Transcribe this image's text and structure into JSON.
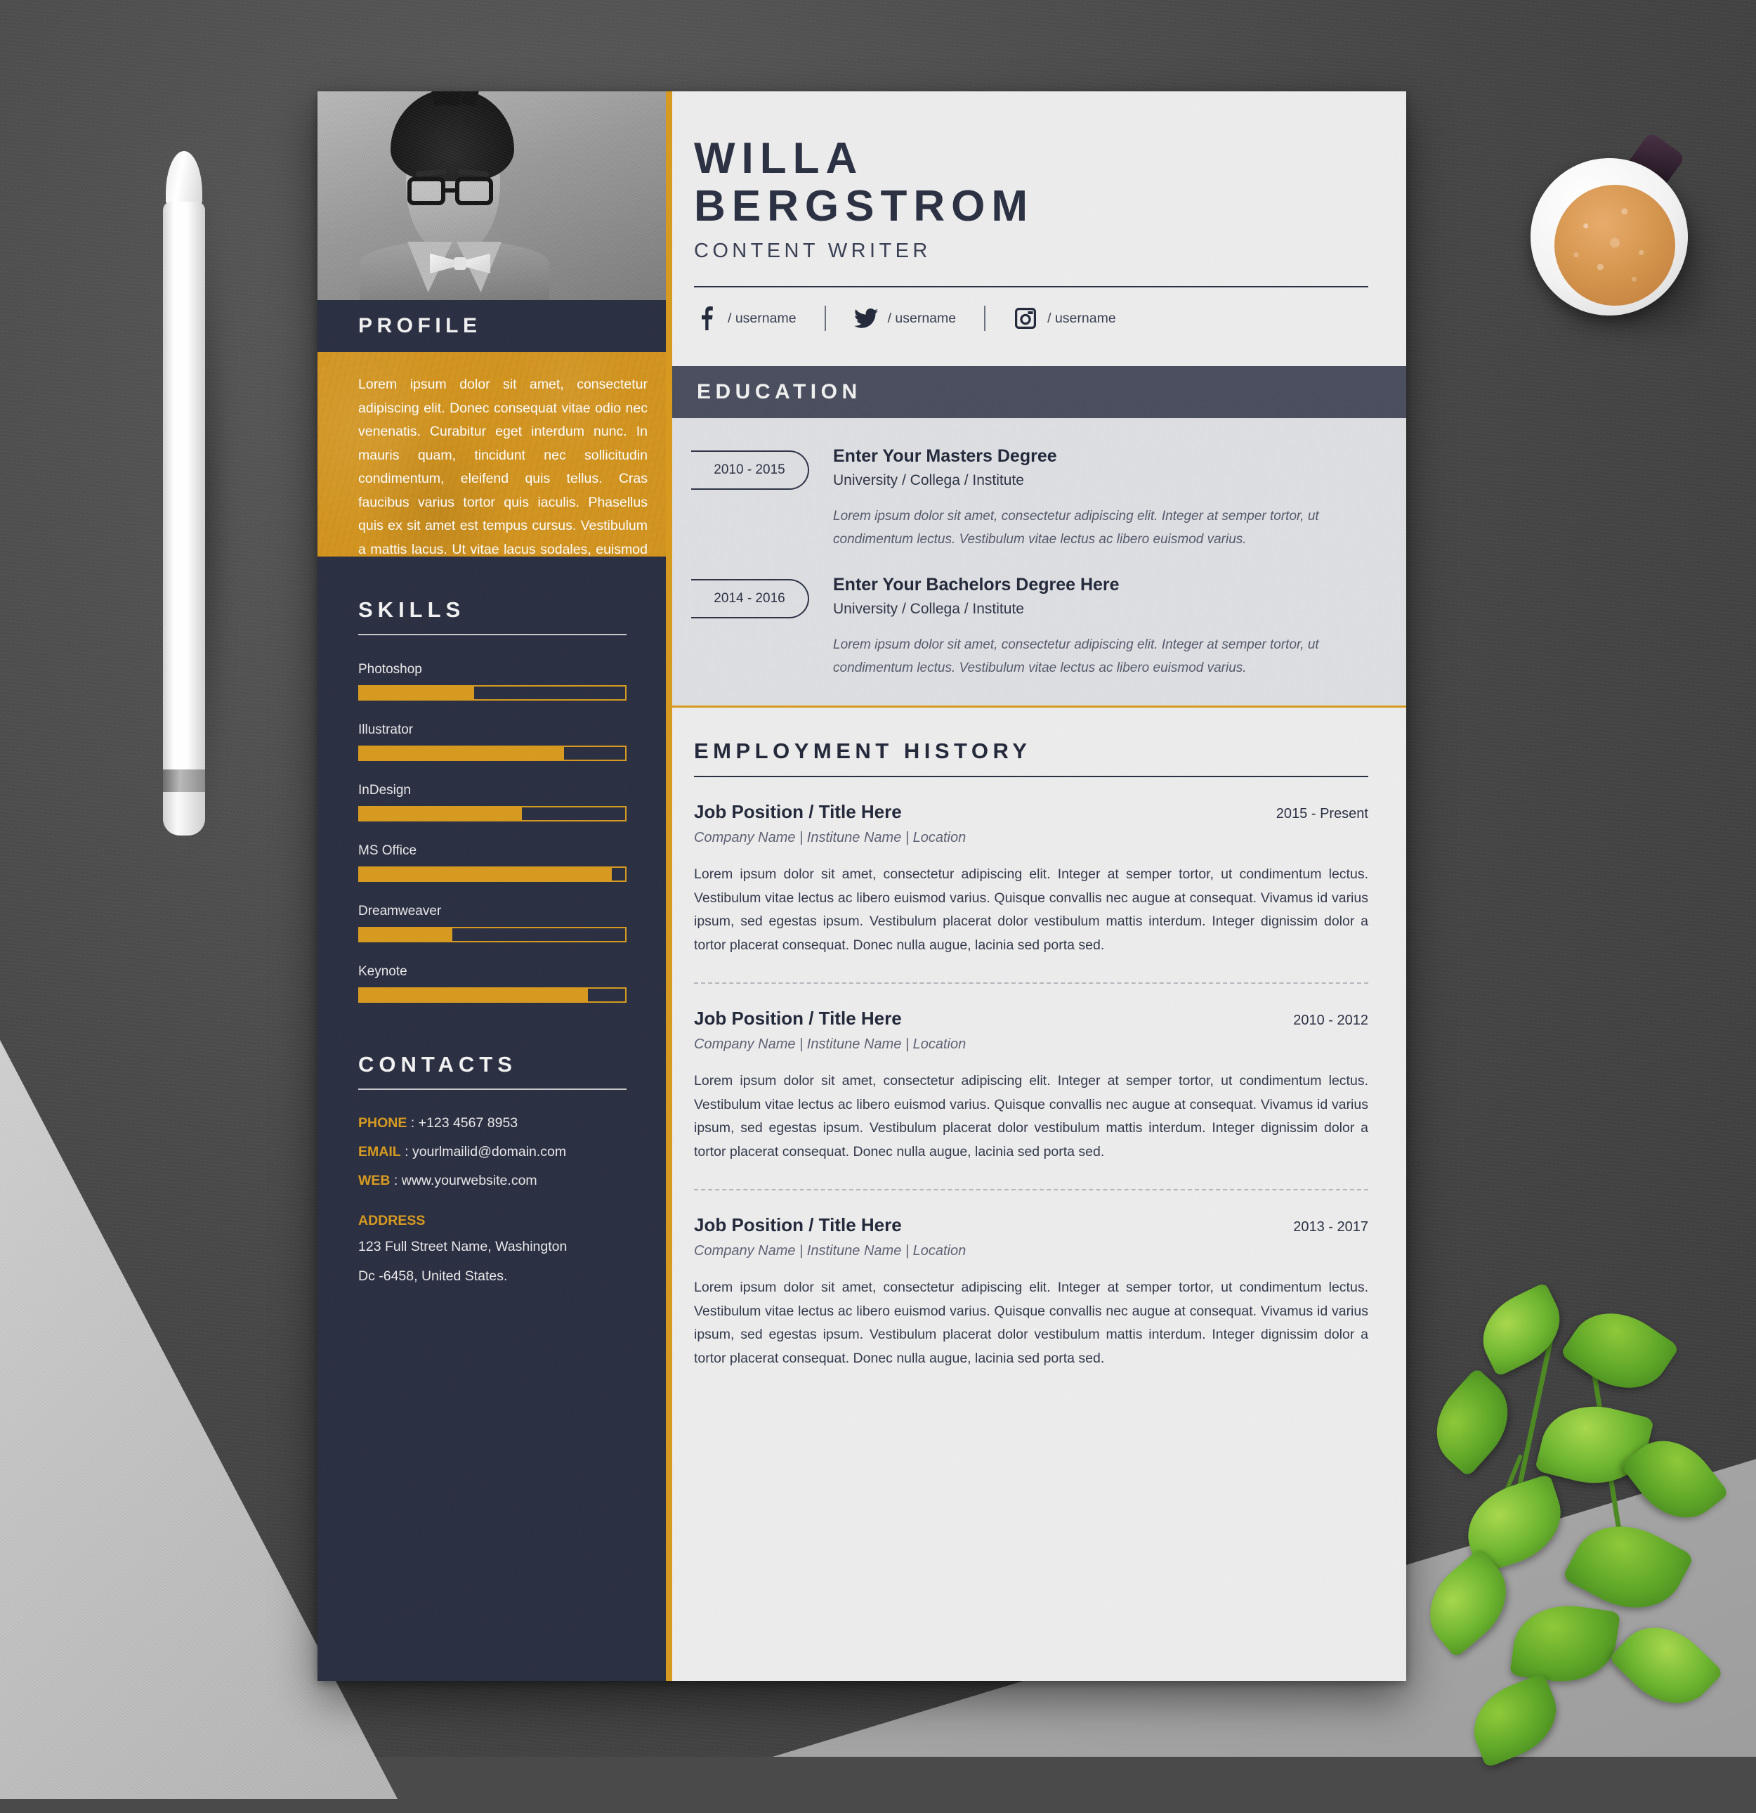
{
  "colors": {
    "accent": "#d79a1f",
    "dark": "#2b2f42",
    "header_bar": "#4a4e5e",
    "paper": "#ececed",
    "edu_bg": "#dddee2"
  },
  "header": {
    "first_name": "WILLA",
    "last_name": "BERGSTROM",
    "role": "CONTENT WRITER",
    "socials": [
      {
        "icon": "facebook-icon",
        "handle": "/ username"
      },
      {
        "icon": "twitter-icon",
        "handle": "/ username"
      },
      {
        "icon": "instagram-icon",
        "handle": "/ username"
      }
    ]
  },
  "profile": {
    "heading": "PROFILE",
    "text": "Lorem ipsum dolor sit amet, consectetur adipiscing elit. Donec consequat vitae odio nec venenatis. Curabitur eget interdum nunc. In mauris quam, tincidunt nec sollicitudin condimentum, eleifend quis tellus. Cras faucibus varius tortor quis iaculis. Phasellus quis ex sit amet est tempus cursus. Vestibulum a mattis lacus. Ut vitae lacus sodales, euismod elit sit amet, interdum ex."
  },
  "education": {
    "heading": "EDUCATION",
    "items": [
      {
        "date": "2010 - 2015",
        "title": "Enter Your Masters Degree",
        "subtitle": "University / Collega / Institute",
        "description": "Lorem ipsum dolor sit amet, consectetur adipiscing elit. Integer at semper tortor, ut condimentum lectus. Vestibulum vitae lectus ac libero euismod varius."
      },
      {
        "date": "2014 - 2016",
        "title": "Enter Your Bachelors Degree Here",
        "subtitle": "University / Collega / Institute",
        "description": "Lorem ipsum dolor sit amet, consectetur adipiscing elit. Integer at semper tortor, ut condimentum lectus. Vestibulum vitae lectus ac libero euismod varius."
      }
    ]
  },
  "skills": {
    "heading": "SKILLS",
    "items": [
      {
        "name": "Photoshop",
        "percent": 43
      },
      {
        "name": "Illustrator",
        "percent": 77
      },
      {
        "name": "InDesign",
        "percent": 61
      },
      {
        "name": "MS Office",
        "percent": 95
      },
      {
        "name": "Dreamweaver",
        "percent": 35
      },
      {
        "name": "Keynote",
        "percent": 86
      }
    ]
  },
  "contacts": {
    "heading": "CONTACTS",
    "rows": [
      {
        "key": "PHONE",
        "sep": " : ",
        "value": "+123 4567 8953"
      },
      {
        "key": "EMAIL",
        "sep": " : ",
        "value": "yourlmailid@domain.com"
      },
      {
        "key": "WEB",
        "sep": " : ",
        "value": "www.yourwebsite.com"
      }
    ],
    "address_label": "ADDRESS",
    "address_line1": "123 Full Street Name, Washington",
    "address_line2": "Dc -6458, United States."
  },
  "employment": {
    "heading": "EMPLOYMENT HISTORY",
    "jobs": [
      {
        "title": "Job Position / Title Here",
        "date": "2015 - Present",
        "meta": "Company Name | Institune Name | Location",
        "description": "Lorem ipsum dolor sit amet, consectetur adipiscing elit. Integer at semper tortor, ut condimentum lectus. Vestibulum vitae lectus ac libero euismod varius. Quisque convallis nec augue at consequat. Vivamus id varius ipsum, sed egestas ipsum. Vestibulum placerat dolor vestibulum mattis interdum. Integer dignissim dolor a tortor placerat consequat. Donec nulla augue, lacinia sed porta sed."
      },
      {
        "title": "Job Position / Title Here",
        "date": "2010 - 2012",
        "meta": "Company Name | Institune Name | Location",
        "description": "Lorem ipsum dolor sit amet, consectetur adipiscing elit. Integer at semper tortor, ut condimentum lectus. Vestibulum vitae lectus ac libero euismod varius. Quisque convallis nec augue at consequat. Vivamus id varius ipsum, sed egestas ipsum. Vestibulum placerat dolor vestibulum mattis interdum. Integer dignissim dolor a tortor placerat consequat. Donec nulla augue, lacinia sed porta sed."
      },
      {
        "title": "Job Position / Title Here",
        "date": "2013 - 2017",
        "meta": "Company Name | Institune Name | Location",
        "description": "Lorem ipsum dolor sit amet, consectetur adipiscing elit. Integer at semper tortor, ut condimentum lectus. Vestibulum vitae lectus ac libero euismod varius. Quisque convallis nec augue at consequat. Vivamus id varius ipsum, sed egestas ipsum. Vestibulum placerat dolor vestibulum mattis interdum. Integer dignissim dolor a tortor placerat consequat. Donec nulla augue, lacinia sed porta sed."
      }
    ]
  },
  "props": {
    "pencil": "white-pencil",
    "coffee": "coffee-cup",
    "plant": "pothos-plant"
  }
}
